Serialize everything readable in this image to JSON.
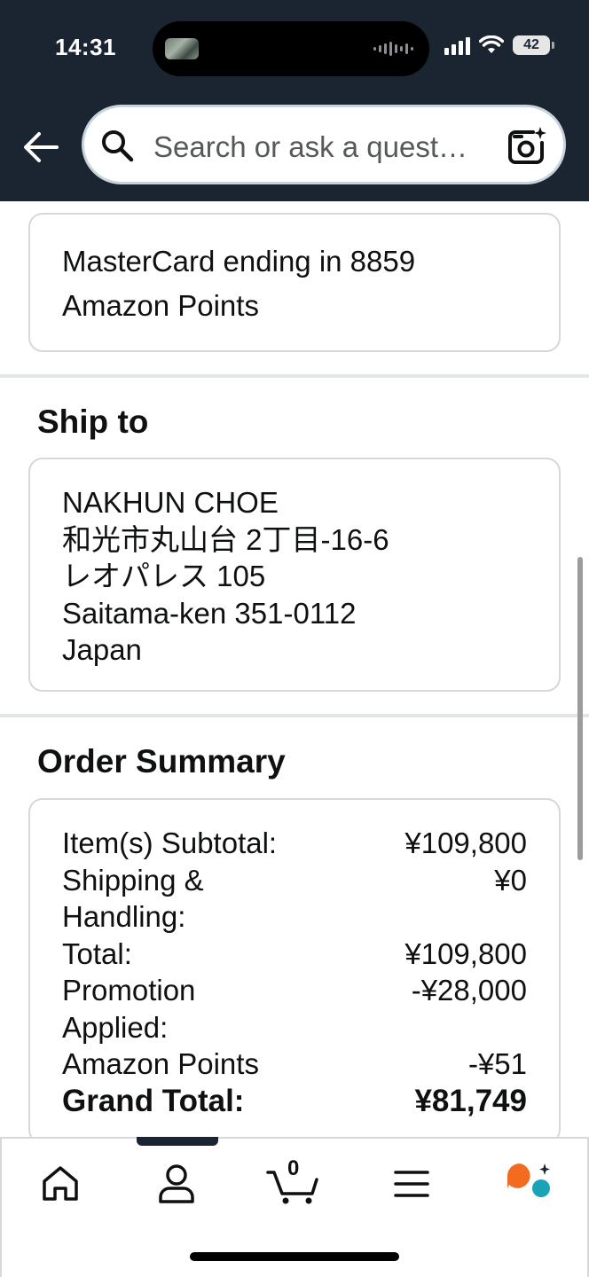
{
  "status_bar": {
    "time": "14:31",
    "battery": "42"
  },
  "header": {
    "search_placeholder": "Search or ask a quest…"
  },
  "payment": {
    "lines": [
      "MasterCard ending in 8859",
      "Amazon Points"
    ]
  },
  "ship_to": {
    "title": "Ship to",
    "lines": [
      "NAKHUN CHOE",
      "和光市丸山台 2丁目-16-6",
      "レオパレス 105",
      "Saitama-ken 351-0112",
      "Japan"
    ]
  },
  "order_summary": {
    "title": "Order Summary",
    "rows": [
      {
        "label": "Item(s) Subtotal:",
        "value": "¥109,800"
      },
      {
        "label": "Shipping & Handling:",
        "value": "¥0"
      },
      {
        "label": "Total:",
        "value": "¥109,800"
      },
      {
        "label": "Promotion Applied:",
        "value": "-¥28,000"
      },
      {
        "label": "Amazon Points",
        "value": "-¥51"
      }
    ],
    "grand_total": {
      "label": "Grand Total:",
      "value": "¥81,749"
    }
  },
  "bottom_nav": {
    "cart_count": "0"
  },
  "colors": {
    "header_bg": "#1b2431",
    "assistant_orange": "#f26b21",
    "assistant_teal": "#1aa3b8"
  }
}
